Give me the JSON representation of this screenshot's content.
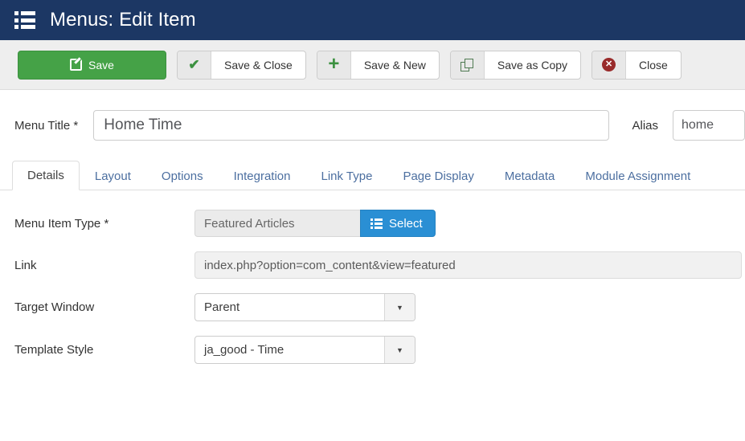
{
  "header": {
    "icon": "menu-list-icon",
    "title": "Menus: Edit Item",
    "bg_color": "#1c3764"
  },
  "toolbar": {
    "buttons": [
      {
        "label": "Save",
        "icon": "pencil-square-icon",
        "style": "primary-green",
        "color": "#45a247"
      },
      {
        "label": "Save & Close",
        "icon": "check-icon",
        "style": "default",
        "color": "#3c9140"
      },
      {
        "label": "Save & New",
        "icon": "plus-icon",
        "style": "default",
        "color": "#3c9140"
      },
      {
        "label": "Save as Copy",
        "icon": "copy-icon",
        "style": "default",
        "color": "#4f7a52"
      },
      {
        "label": "Close",
        "icon": "x-circle-icon",
        "style": "default",
        "color": "#992b2b"
      }
    ]
  },
  "title_row": {
    "menu_title_label": "Menu Title *",
    "menu_title_value": "Home Time",
    "menu_title_placeholder": "",
    "alias_label": "Alias",
    "alias_value": "home",
    "alias_placeholder": ""
  },
  "tabs": [
    {
      "label": "Details",
      "active": true
    },
    {
      "label": "Layout",
      "active": false
    },
    {
      "label": "Options",
      "active": false
    },
    {
      "label": "Integration",
      "active": false
    },
    {
      "label": "Link Type",
      "active": false
    },
    {
      "label": "Page Display",
      "active": false
    },
    {
      "label": "Metadata",
      "active": false
    },
    {
      "label": "Module Assignment",
      "active": false
    }
  ],
  "form": {
    "menu_item_type": {
      "label": "Menu Item Type *",
      "value": "Featured Articles",
      "select_button_label": "Select",
      "select_button_icon": "menu-list-icon",
      "select_button_color": "#2a8fd4"
    },
    "link": {
      "label": "Link",
      "value": "index.php?option=com_content&view=featured"
    },
    "target_window": {
      "label": "Target Window",
      "value": "Parent"
    },
    "template_style": {
      "label": "Template Style",
      "value": "ja_good - Time"
    }
  }
}
